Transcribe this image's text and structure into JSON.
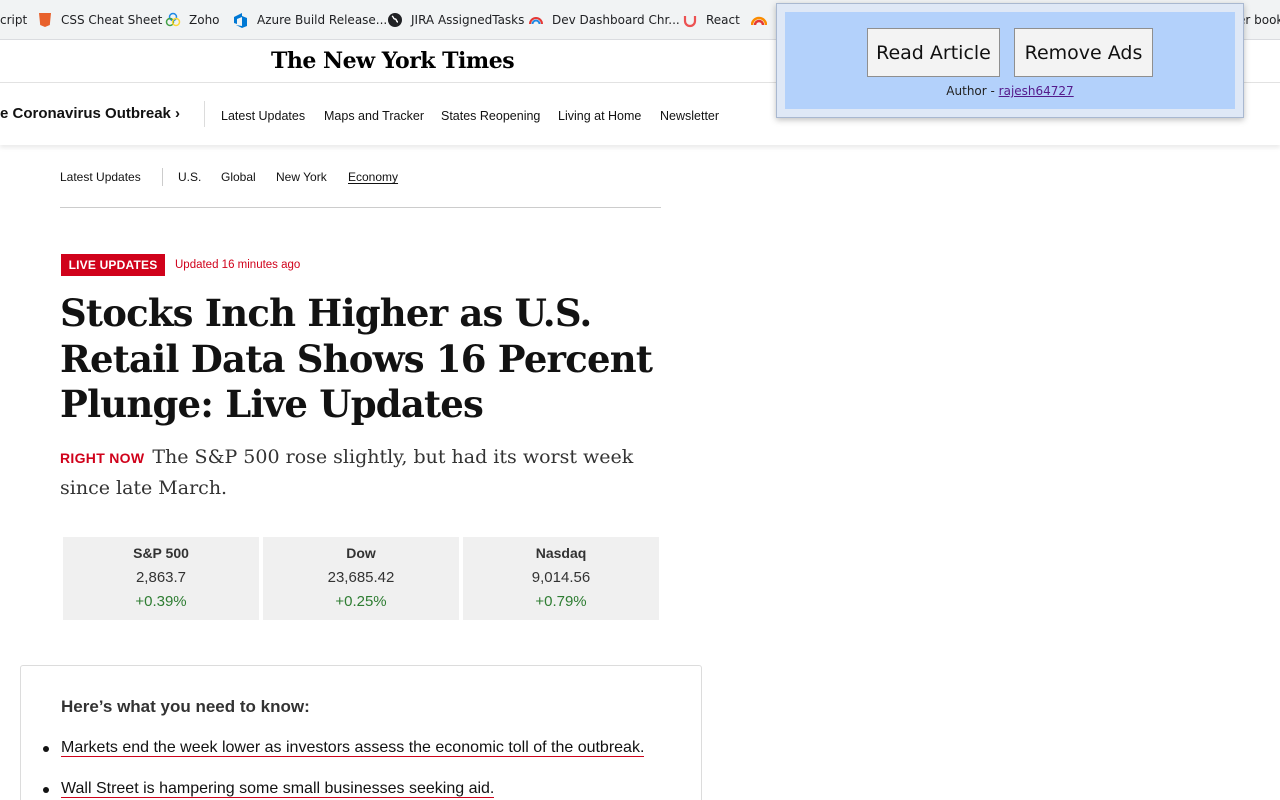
{
  "bookmarks": [
    {
      "label": "cript",
      "icon": "script-icon",
      "color": "#f1f3f4"
    },
    {
      "label": "CSS Cheat Sheet",
      "icon": "css-icon",
      "color": "#e8612c"
    },
    {
      "label": "Zoho",
      "icon": "zoho-icon",
      "color": "#1e88e5"
    },
    {
      "label": "Azure Build Release...",
      "icon": "azure-devops-icon",
      "color": "#0078d4"
    },
    {
      "label": "JIRA AssignedTasks",
      "icon": "globe-icon",
      "color": "#202124"
    },
    {
      "label": "Dev Dashboard Chr...",
      "icon": "chrome-rainbow-icon",
      "color": "#e53935"
    },
    {
      "label": "React",
      "icon": "udemy-icon",
      "color": "#ec5252"
    },
    {
      "label": "",
      "icon": "rainbow-icon",
      "color": "#fb8c00"
    },
    {
      "label": "er book",
      "icon": "",
      "color": ""
    }
  ],
  "masthead": {
    "logo": "The New York Times"
  },
  "topnav": {
    "lead": "e Coronavirus Outbreak ›",
    "items": [
      "Latest Updates",
      "Maps and Tracker",
      "States Reopening",
      "Living at Home",
      "Newsletter"
    ]
  },
  "subnav": {
    "items": [
      "Latest Updates",
      "U.S.",
      "Global",
      "New York",
      "Economy"
    ],
    "active": "Economy"
  },
  "live": {
    "badge": "LIVE UPDATES",
    "updated": "Updated 16 minutes ago"
  },
  "headline": "Stocks Inch Higher as U.S. Retail Data Shows 16 Percent Plunge: Live Updates",
  "right_now": {
    "label": "RIGHT NOW",
    "text": "The S&P 500 rose slightly, but had its worst week since late March."
  },
  "tickers": [
    {
      "name": "S&P 500",
      "value": "2,863.7",
      "change": "+0.39%"
    },
    {
      "name": "Dow",
      "value": "23,685.42",
      "change": "+0.25%"
    },
    {
      "name": "Nasdaq",
      "value": "9,014.56",
      "change": "+0.79%"
    }
  ],
  "briefing": {
    "heading": "Here’s what you need to know:",
    "items": [
      "Markets end the week lower as investors assess the economic toll of the outbreak.",
      "Wall Street is hampering some small businesses seeking aid."
    ]
  },
  "popup": {
    "read_article": "Read Article",
    "remove_ads": "Remove Ads",
    "author_prefix": "Author - ",
    "author_name": "rajesh64727"
  },
  "colors": {
    "accent_red": "#d0021b",
    "gain_green": "#2e7d32",
    "popup_bg": "#b3d1fb"
  }
}
